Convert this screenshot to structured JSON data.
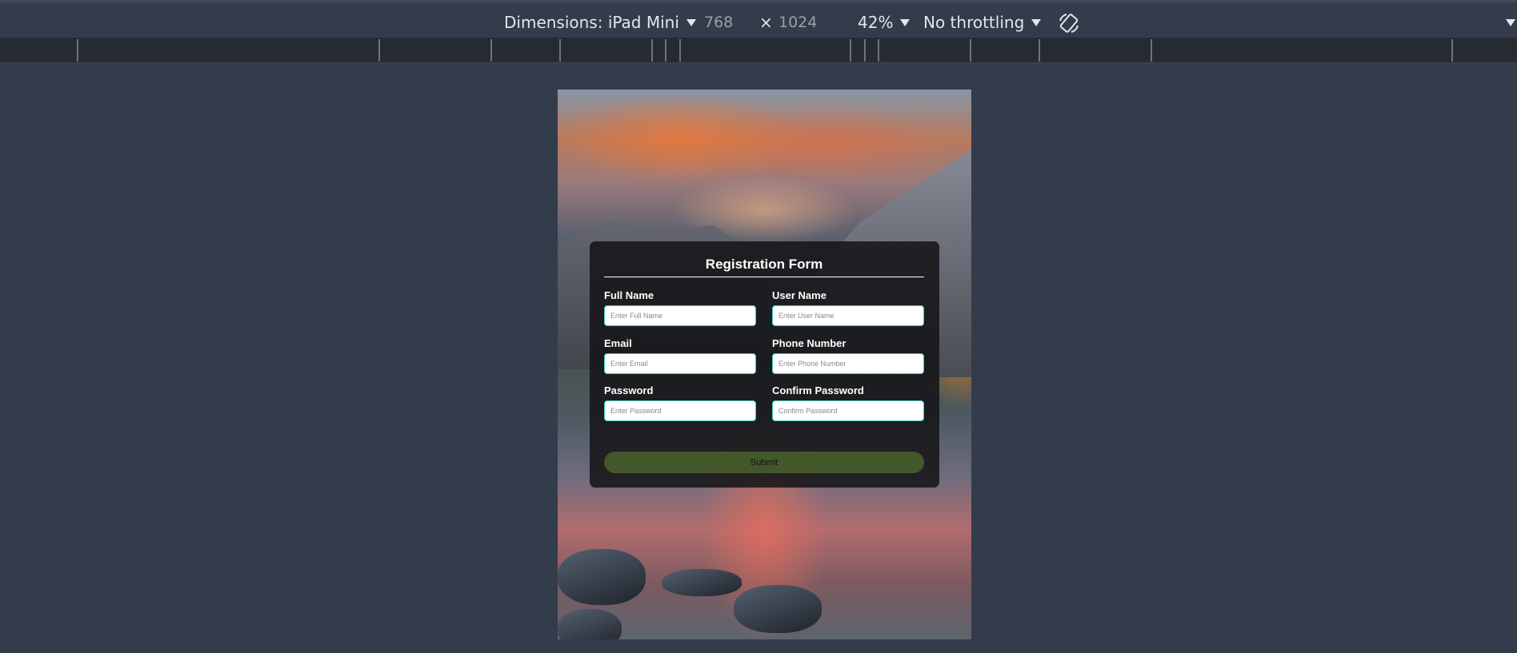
{
  "device_toolbar": {
    "dimensions_label": "Dimensions: iPad Mini",
    "width_value": "768",
    "times_symbol": "×",
    "height_value": "1024",
    "zoom_label": "42%",
    "throttling_label": "No throttling",
    "rotate_icon": "rotate-icon",
    "more_icon": "chevron-down-icon"
  },
  "page": {
    "form": {
      "title": "Registration Form",
      "fields": [
        {
          "label": "Full Name",
          "placeholder": "Enter Full Name"
        },
        {
          "label": "User Name",
          "placeholder": "Enter User Name"
        },
        {
          "label": "Email",
          "placeholder": "Enter Email"
        },
        {
          "label": "Phone Number",
          "placeholder": "Enter Phone Number"
        },
        {
          "label": "Password",
          "placeholder": "Enter Password"
        },
        {
          "label": "Confirm Password",
          "placeholder": "Confirm Password"
        }
      ],
      "submit_label": "Submit"
    }
  },
  "colors": {
    "devtools_background": "#333c4b",
    "ruler_background": "#252a33",
    "form_background": "#141416",
    "input_border": "#3fd0c0",
    "submit_background": "#43572a"
  }
}
